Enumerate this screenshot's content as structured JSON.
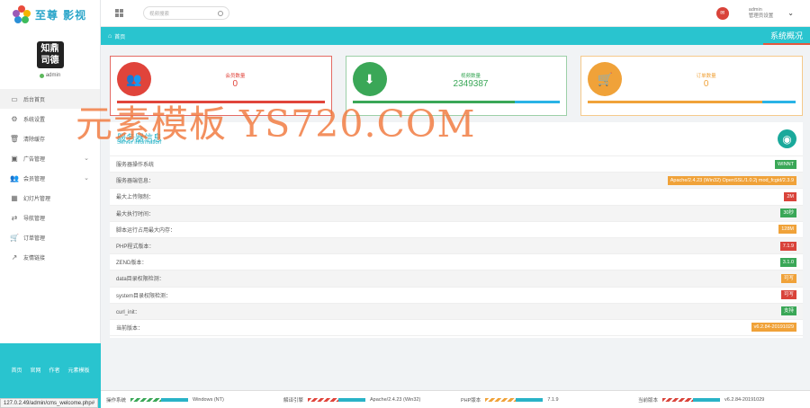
{
  "brand": {
    "name": "至尊 影视",
    "colors": [
      "#e94b3c",
      "#f4b400",
      "#3dbb5c",
      "#2a8fd6",
      "#9b59b6"
    ]
  },
  "user": {
    "avatar_text_1": "知鼎",
    "avatar_text_2": "司德",
    "name": "admin",
    "status_color": "#5cb85c"
  },
  "sidebar": {
    "items": [
      {
        "label": "后台首页",
        "icon": "laptop-icon",
        "glyph": "▭",
        "active": true,
        "caret": false
      },
      {
        "label": "系统设置",
        "icon": "settings-icon",
        "glyph": "⚙",
        "active": false,
        "caret": false
      },
      {
        "label": "清除缓存",
        "icon": "trash-icon",
        "glyph": "🗑",
        "active": false,
        "caret": false
      },
      {
        "label": "广告管理",
        "icon": "image-icon",
        "glyph": "▣",
        "active": false,
        "caret": true
      },
      {
        "label": "会员管理",
        "icon": "users-icon",
        "glyph": "👥",
        "active": false,
        "caret": true
      },
      {
        "label": "幻灯片管理",
        "icon": "table-icon",
        "glyph": "▦",
        "active": false,
        "caret": false
      },
      {
        "label": "导航管理",
        "icon": "shuffle-icon",
        "glyph": "⇄",
        "active": false,
        "caret": false
      },
      {
        "label": "订单管理",
        "icon": "cart-icon",
        "glyph": "🛒",
        "active": false,
        "caret": false
      },
      {
        "label": "友情链接",
        "icon": "external-link-icon",
        "glyph": "↗",
        "active": false,
        "caret": false
      }
    ],
    "footer_links": [
      "首页",
      "官网",
      "作者",
      "元素模板"
    ]
  },
  "status_url": "127.0.2.49/admin/cms_welcome.php#",
  "topbar": {
    "search_placeholder": "视频搜索",
    "user_name": "admin",
    "user_role": "管理员设置"
  },
  "breadcrumb": {
    "home": "首页",
    "page_title": "系统概况"
  },
  "stats": [
    {
      "label": "会员数量",
      "value": "0",
      "color": "#e0443b",
      "border": "#e46a63",
      "icon": "users-icon",
      "glyph": "👥",
      "bar": [
        [
          "#e0443b",
          1.0
        ]
      ]
    },
    {
      "label": "视频数量",
      "value": "2349387",
      "color": "#3aa757",
      "border": "#9ccfa7",
      "icon": "download-icon",
      "glyph": "⬇",
      "bar": [
        [
          "#3aa757",
          0.78
        ],
        [
          "#29b3e6",
          0.22
        ]
      ]
    },
    {
      "label": "订单数量",
      "value": "0",
      "color": "#f0a239",
      "border": "#f5c98b",
      "icon": "cart-icon",
      "glyph": "🛒",
      "bar": [
        [
          "#f0a239",
          0.84
        ],
        [
          "#29b3e6",
          0.16
        ]
      ]
    }
  ],
  "server": {
    "title": "服务器信息",
    "subtitle": "Server information",
    "rows": [
      {
        "label": "服务器操作系统",
        "value": "WINNT",
        "color": "#3aa757"
      },
      {
        "label": "服务器端信息：",
        "value": "Apache/2.4.23 (Win32) OpenSSL/1.0.2j mod_fcgid/2.3.9",
        "color": "#f0a239"
      },
      {
        "label": "最大上传限制：",
        "value": "2M",
        "color": "#d9433a"
      },
      {
        "label": "最大执行时间：",
        "value": "30秒",
        "color": "#3aa757"
      },
      {
        "label": "脚本运行占用最大内存：",
        "value": "128M",
        "color": "#f0a239"
      },
      {
        "label": "PHP程式版本：",
        "value": "7.1.9",
        "color": "#d9433a"
      },
      {
        "label": "ZEND版本：",
        "value": "3.1.0",
        "color": "#3aa757"
      },
      {
        "label": "data目录权限检测：",
        "value": "可写",
        "color": "#f0a239"
      },
      {
        "label": "system目录权限检测：",
        "value": "可写",
        "color": "#d9433a"
      },
      {
        "label": "curl_init：",
        "value": "支持",
        "color": "#3aa757"
      },
      {
        "label": "当前版本：",
        "value": "v6.2.84-20191029",
        "color": "#f0a239"
      }
    ]
  },
  "strip": [
    {
      "label": "操作系统",
      "value": "Windows (NT)",
      "colors": [
        "#3aa757",
        "#29b3c7"
      ]
    },
    {
      "label": "解译引擎",
      "value": "Apache/2.4.23 (Win32)",
      "colors": [
        "#e0443b",
        "#29b3c7"
      ]
    },
    {
      "label": "PHP版本",
      "value": "7.1.9",
      "colors": [
        "#f0a239",
        "#29b3c7"
      ]
    },
    {
      "label": "当前版本",
      "value": "v6.2.84-20191029",
      "colors": [
        "#d9433a",
        "#29b3c7"
      ]
    }
  ],
  "watermark": "元素模板 YS720.COM"
}
